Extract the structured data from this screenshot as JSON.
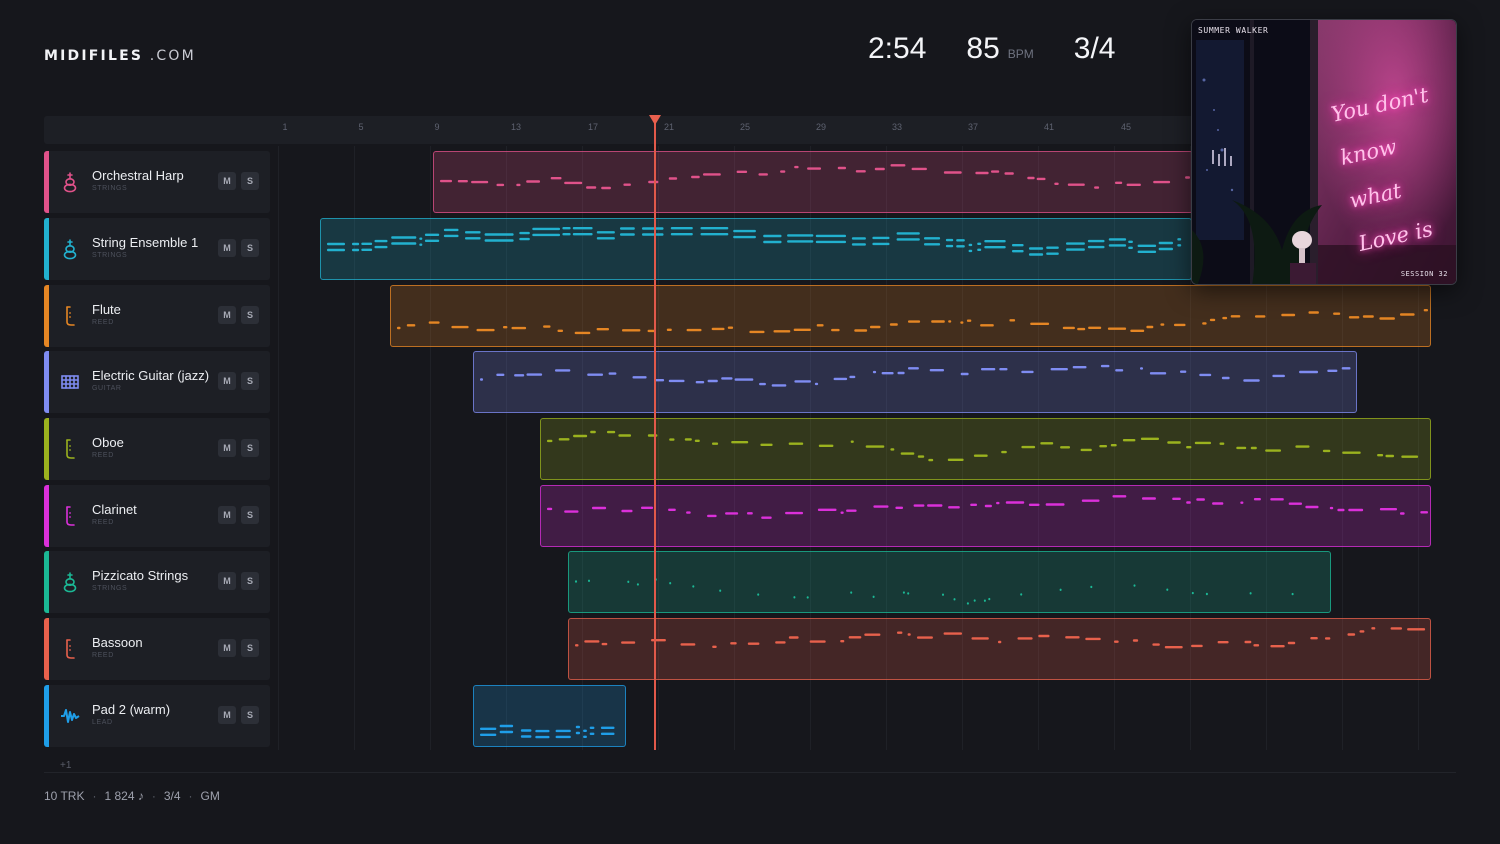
{
  "header": {
    "logo_bold": "MIDIFILES",
    "logo_rest": ".COM",
    "time": "2:54",
    "tempo": "85",
    "tempo_unit": "BPM",
    "meter": "3/4"
  },
  "ruler": {
    "ticks": [
      "1",
      "5",
      "9",
      "13",
      "17",
      "21",
      "25",
      "29",
      "33",
      "37",
      "41",
      "45"
    ],
    "playhead_label": ""
  },
  "tracks": [
    {
      "name": "Orchestral Harp",
      "category": "STRINGS",
      "color": "#e0528a",
      "icon": "harp-icon",
      "mute": "M",
      "solo": "S"
    },
    {
      "name": "String Ensemble 1",
      "category": "STRINGS",
      "color": "#22b1cf",
      "icon": "violin-icon",
      "mute": "M",
      "solo": "S"
    },
    {
      "name": "Flute",
      "category": "REED",
      "color": "#e58624",
      "icon": "reed-icon",
      "mute": "M",
      "solo": "S"
    },
    {
      "name": "Electric Guitar (jazz)",
      "category": "GUITAR",
      "color": "#7f8cf2",
      "icon": "guitar-fretboard-icon",
      "mute": "M",
      "solo": "S"
    },
    {
      "name": "Oboe",
      "category": "REED",
      "color": "#9bb21e",
      "icon": "reed-icon",
      "mute": "M",
      "solo": "S"
    },
    {
      "name": "Clarinet",
      "category": "REED",
      "color": "#db30da",
      "icon": "reed-icon",
      "mute": "M",
      "solo": "S"
    },
    {
      "name": "Pizzicato Strings",
      "category": "STRINGS",
      "color": "#1bb895",
      "icon": "violin-icon",
      "mute": "M",
      "solo": "S"
    },
    {
      "name": "Bassoon",
      "category": "REED",
      "color": "#e8614c",
      "icon": "reed-icon",
      "mute": "M",
      "solo": "S"
    },
    {
      "name": "Pad 2 (warm)",
      "category": "LEAD",
      "color": "#1f9ee8",
      "icon": "waveform-icon",
      "mute": "M",
      "solo": "S"
    }
  ],
  "more_tracks": "+1",
  "footer": {
    "tracks": "10 TRK",
    "notes": "1 824 ♪",
    "meter": "3/4",
    "standard": "GM"
  },
  "cover": {
    "artist": "SUMMER WALKER",
    "session": "SESSION 32",
    "neon_lines": [
      "You don't",
      "know what",
      "Love is"
    ]
  }
}
